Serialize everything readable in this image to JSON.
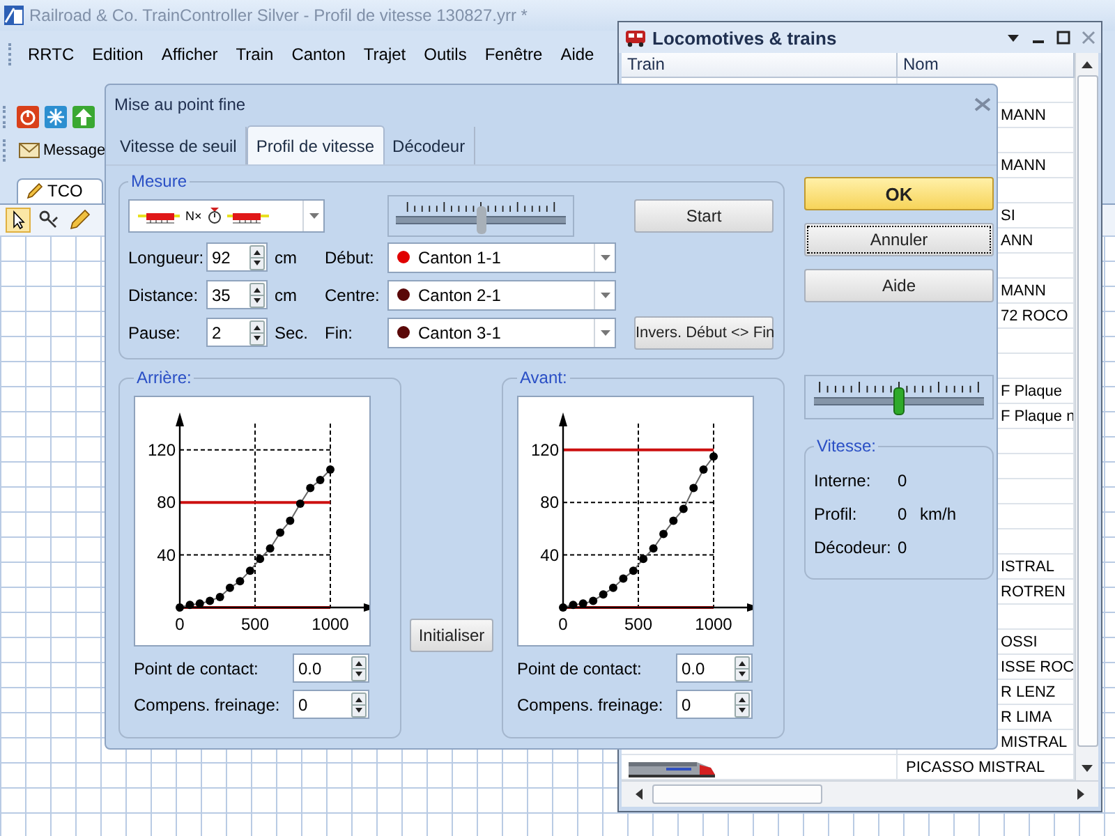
{
  "app": {
    "title": "Railroad & Co. TrainController Silver - Profil de vitesse 130827.yrr *",
    "menu": [
      "RRTC",
      "Edition",
      "Afficher",
      "Train",
      "Canton",
      "Trajet",
      "Outils",
      "Fenêtre",
      "Aide"
    ],
    "toolbar_button": "Message",
    "tabs": [
      {
        "label": "TCO",
        "selected": true
      }
    ]
  },
  "locomotives_window": {
    "title": "Locomotives & trains",
    "columns": [
      "Train",
      "Nom"
    ],
    "rows": [
      {
        "kind": "blank"
      },
      {
        "kind": "text",
        "name": "MANN"
      },
      {
        "kind": "blank"
      },
      {
        "kind": "text",
        "name": "MANN"
      },
      {
        "kind": "blank"
      },
      {
        "kind": "text",
        "name": "SI"
      },
      {
        "kind": "text",
        "name": "ANN"
      },
      {
        "kind": "blank"
      },
      {
        "kind": "text",
        "name": "MANN"
      },
      {
        "kind": "text",
        "name": "72 ROCO"
      },
      {
        "kind": "blank"
      },
      {
        "kind": "blank"
      },
      {
        "kind": "text",
        "name": "F Plaque"
      },
      {
        "kind": "text",
        "name": "F Plaque n"
      },
      {
        "kind": "blank"
      },
      {
        "kind": "blank"
      },
      {
        "kind": "blank"
      },
      {
        "kind": "blank"
      },
      {
        "kind": "blank"
      },
      {
        "kind": "text",
        "name": "ISTRAL"
      },
      {
        "kind": "text",
        "name": "ROTREN"
      },
      {
        "kind": "blank"
      },
      {
        "kind": "text",
        "name": "OSSI"
      },
      {
        "kind": "text",
        "name": "ISSE ROC"
      },
      {
        "kind": "text",
        "name": "R LENZ"
      },
      {
        "kind": "text",
        "name": "R LIMA"
      },
      {
        "kind": "text",
        "name": "MISTRAL"
      },
      {
        "kind": "thumbnail",
        "name": "PICASSO MISTRAL"
      }
    ]
  },
  "dialog": {
    "title": "Mise au point fine",
    "tabs": [
      {
        "label": "Vitesse de seuil",
        "selected": false
      },
      {
        "label": "Profil de vitesse",
        "selected": true
      },
      {
        "label": "Décodeur",
        "selected": false
      }
    ],
    "measure": {
      "title": "Mesure",
      "mode_label": "N×",
      "speed_slider": {
        "level": 0.5
      },
      "start_button": "Start",
      "fields": [
        {
          "label": "Longueur:",
          "value": "92",
          "unit": "cm"
        },
        {
          "label": "Distance:",
          "value": "35",
          "unit": "cm"
        },
        {
          "label": "Pause:",
          "value": "2",
          "unit": "Sec."
        }
      ],
      "blocks": [
        {
          "label": "Début:",
          "value": "Canton 1-1",
          "color": "#e00000"
        },
        {
          "label": "Centre:",
          "value": "Canton 2-1",
          "color": "#5a0808"
        },
        {
          "label": "Fin:",
          "value": "Canton 3-1",
          "color": "#5a0808"
        }
      ],
      "swap_button": "Invers. Début <> Fin"
    },
    "rear": {
      "title": "Arrière:",
      "chart_data": {
        "type": "line",
        "x": [
          0,
          67,
          133,
          200,
          267,
          333,
          400,
          467,
          533,
          600,
          667,
          733,
          800,
          867,
          933,
          1000
        ],
        "series": [
          {
            "marker": "circle",
            "values": [
              0,
              2,
              3,
              5,
              8,
              15,
              20,
              28,
              37,
              45,
              57,
              66,
              79,
              91,
              97,
              105
            ]
          }
        ],
        "xlim": [
          0,
          1000
        ],
        "ylim": [
          0,
          140
        ],
        "xticks": [
          0,
          500,
          1000
        ],
        "yticks": [
          40,
          80,
          120
        ],
        "grid": true,
        "ref_lines": [
          {
            "axis": "y",
            "value": 80
          },
          {
            "axis": "y",
            "value": 0
          }
        ]
      },
      "contact": {
        "label": "Point de contact:",
        "value": "0.0"
      },
      "brake": {
        "label": "Compens. freinage:",
        "value": "0"
      }
    },
    "initialize_button": "Initialiser",
    "front": {
      "title": "Avant:",
      "chart_data": {
        "type": "line",
        "x": [
          0,
          67,
          133,
          200,
          267,
          333,
          400,
          467,
          533,
          600,
          667,
          733,
          800,
          867,
          933,
          1000
        ],
        "series": [
          {
            "marker": "circle",
            "values": [
              0,
              2,
              3,
              5,
              10,
              15,
              22,
              28,
              37,
              45,
              56,
              66,
              75,
              91,
              105,
              115
            ]
          }
        ],
        "xlim": [
          0,
          1000
        ],
        "ylim": [
          0,
          140
        ],
        "xticks": [
          0,
          500,
          1000
        ],
        "yticks": [
          40,
          80,
          120
        ],
        "grid": true,
        "ref_lines": [
          {
            "axis": "y",
            "value": 120
          },
          {
            "axis": "y",
            "value": 0
          }
        ]
      },
      "contact": {
        "label": "Point de contact:",
        "value": "0.0"
      },
      "brake": {
        "label": "Compens. freinage:",
        "value": "0"
      }
    },
    "buttons": [
      {
        "label": "OK",
        "kind": "default"
      },
      {
        "label": "Annuler",
        "kind": "focused"
      },
      {
        "label": "Aide",
        "kind": "normal"
      }
    ],
    "throttle": {
      "level": 0.5
    },
    "speed": {
      "title": "Vitesse:",
      "rows": [
        {
          "label": "Interne:",
          "value": "0"
        },
        {
          "label": "Profil:",
          "value": "0",
          "unit": "km/h"
        },
        {
          "label": "Décodeur:",
          "value": "0"
        }
      ]
    }
  }
}
